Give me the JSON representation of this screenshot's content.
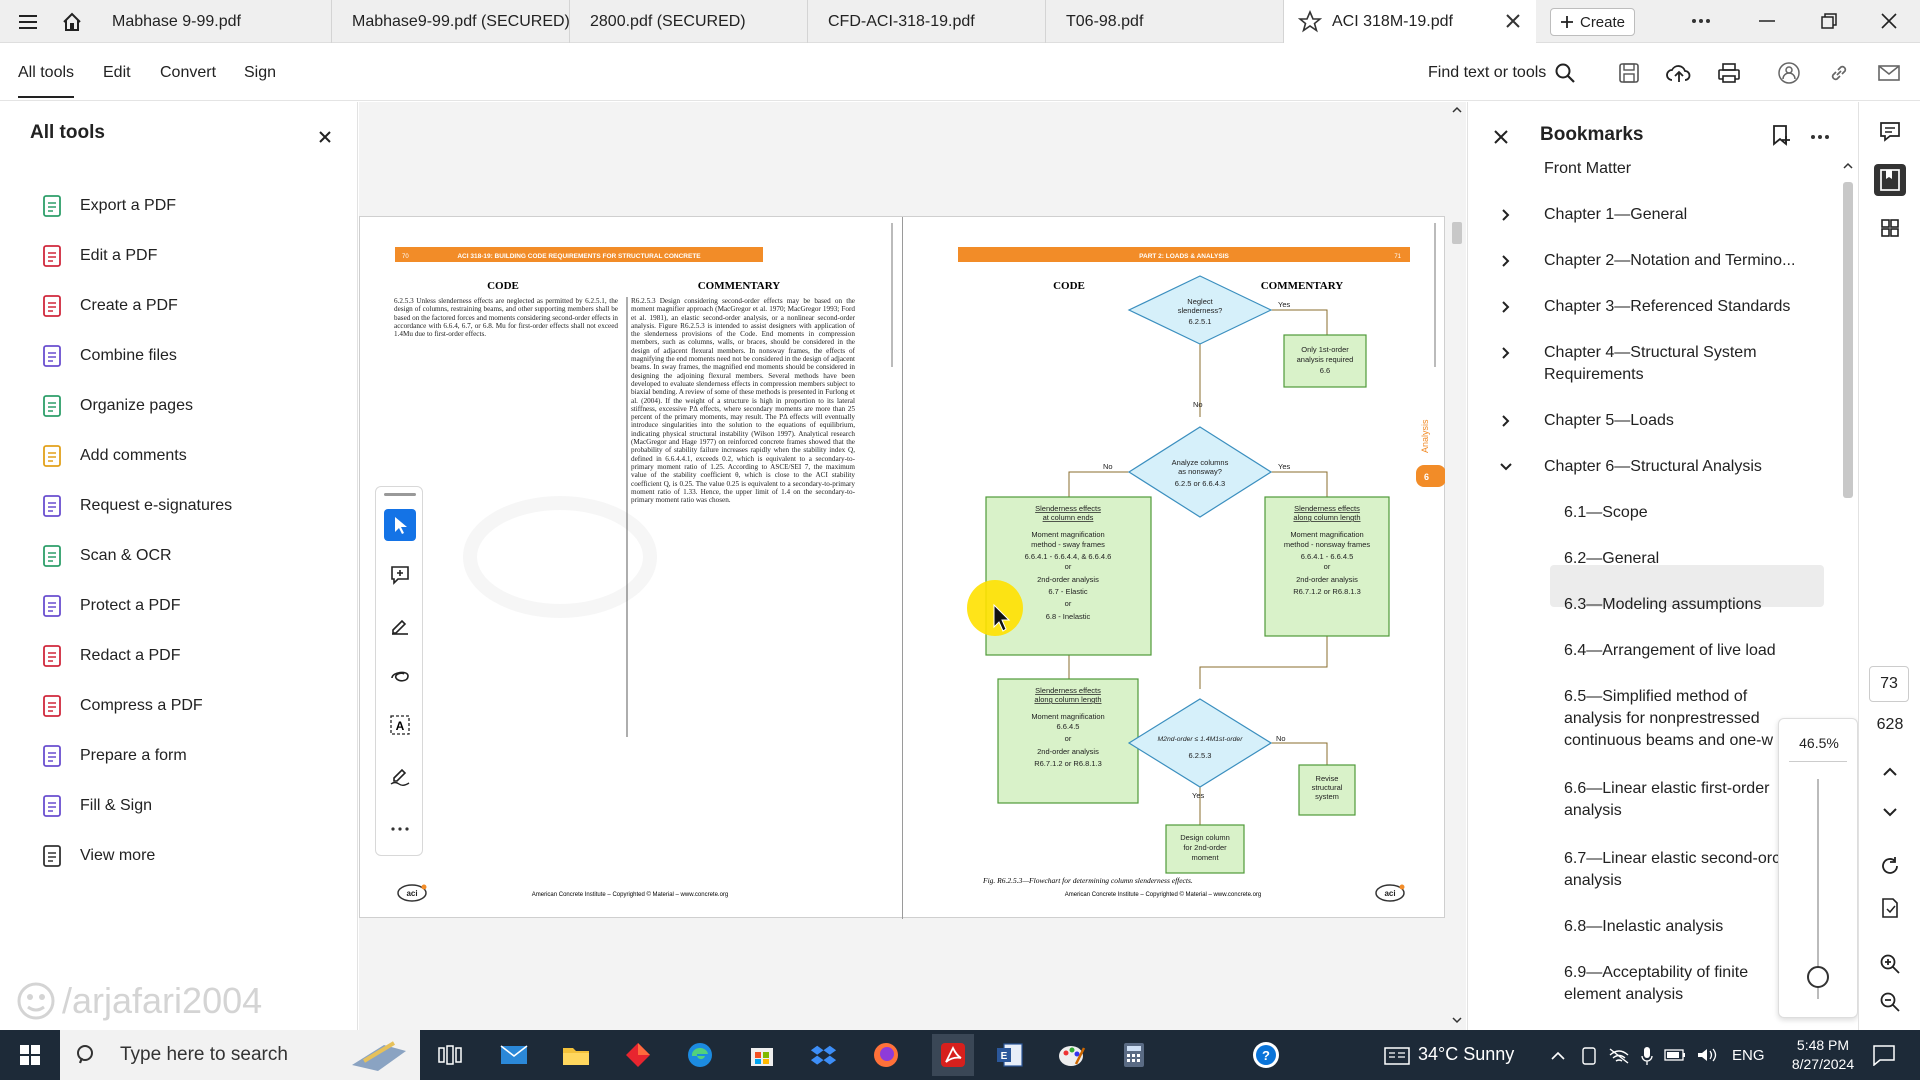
{
  "tabs": [
    {
      "label": "Mabhase 9-99.pdf"
    },
    {
      "label": "Mabhase9-99.pdf (SECURED)"
    },
    {
      "label": "2800.pdf (SECURED)"
    },
    {
      "label": "CFD-ACI-318-19.pdf"
    },
    {
      "label": "T06-98.pdf"
    },
    {
      "label": "ACI 318M-19.pdf"
    }
  ],
  "create_label": "Create",
  "menu": {
    "all_tools": "All tools",
    "edit": "Edit",
    "convert": "Convert",
    "sign": "Sign",
    "find": "Find text or tools"
  },
  "left_panel": {
    "title": "All tools",
    "tools": [
      {
        "label": "Export a PDF",
        "color": "#2e9e6a"
      },
      {
        "label": "Edit a PDF",
        "color": "#d0283c"
      },
      {
        "label": "Create a PDF",
        "color": "#d0283c"
      },
      {
        "label": "Combine files",
        "color": "#6a4fcf"
      },
      {
        "label": "Organize pages",
        "color": "#2e9e6a"
      },
      {
        "label": "Add comments",
        "color": "#e2a11b"
      },
      {
        "label": "Request e-signatures",
        "color": "#6a4fcf"
      },
      {
        "label": "Scan & OCR",
        "color": "#2e9e6a"
      },
      {
        "label": "Protect a PDF",
        "color": "#6a4fcf"
      },
      {
        "label": "Redact a PDF",
        "color": "#d0283c"
      },
      {
        "label": "Compress a PDF",
        "color": "#d0283c"
      },
      {
        "label": "Prepare a form",
        "color": "#6a4fcf"
      },
      {
        "label": "Fill & Sign",
        "color": "#6a4fcf"
      },
      {
        "label": "View more",
        "color": "#333333"
      }
    ],
    "watermark": "/arjafari2004"
  },
  "left_page": {
    "header": "ACI 318-19: BUILDING CODE REQUIREMENTS FOR STRUCTURAL CONCRETE",
    "page_no": "70",
    "code_heading": "CODE",
    "commentary_heading": "COMMENTARY",
    "code_text": "6.2.5.3 Unless slenderness effects are neglected as permitted by 6.2.5.1, the design of columns, restraining beams, and other supporting members shall be based on the factored forces and moments considering second-order effects in accordance with 6.6.4, 6.7, or 6.8. Mu for first-order effects shall not exceed 1.4Mu due to first-order effects.",
    "commentary_text": "R6.2.5.3 Design considering second-order effects may be based on the moment magnifier approach (MacGregor et al. 1970; MacGregor 1993; Ford et al. 1981), an elastic second-order analysis, or a nonlinear second-order analysis. Figure R6.2.5.3 is intended to assist designers with application of the slenderness provisions of the Code. End moments in compression members, such as columns, walls, or braces, should be considered in the design of adjacent flexural members. In nonsway frames, the effects of magnifying the end moments need not be considered in the design of adjacent beams. In sway frames, the magnified end moments should be considered in designing the adjoining flexural members. Several methods have been developed to evaluate slenderness effects in compression members subject to biaxial bending. A review of some of these methods is presented in Furlong et al. (2004). If the weight of a structure is high in proportion to its lateral stiffness, excessive PΔ effects, where secondary moments are more than 25 percent of the primary moments, may result. The PΔ effects will eventually introduce singularities into the solution to the equations of equilibrium, indicating physical structural instability (Wilson 1997). Analytical research (MacGregor and Hage 1977) on reinforced concrete frames showed that the probability of stability failure increases rapidly when the stability index Q, defined in 6.6.4.4.1, exceeds 0.2, which is equivalent to a secondary-to-primary moment ratio of 1.25. According to ASCE/SEI 7, the maximum value of the stability coefficient θ, which is close to the ACI stability coefficient Q, is 0.25. The value 0.25 is equivalent to a secondary-to-primary moment ratio of 1.33. Hence, the upper limit of 1.4 on the secondary-to-primary moment ratio was chosen.",
    "footer": "American Concrete Institute – Copyrighted © Material – www.concrete.org"
  },
  "right_page": {
    "header": "PART 2: LOADS & ANALYSIS",
    "page_no": "71",
    "code_heading": "CODE",
    "commentary_heading": "COMMENTARY",
    "side_tab": "Analysis",
    "side_tab_no": "6",
    "flow": {
      "d1": [
        "Neglect",
        "slenderness?",
        "6.2.5.1"
      ],
      "yes": "Yes",
      "no": "No",
      "b1": [
        "Only 1st-order",
        "analysis required",
        "6.6"
      ],
      "d2": [
        "Analyze columns",
        "as nonsway?",
        "6.2.5 or 6.6.4.3"
      ],
      "b2_title": [
        "Slenderness effects",
        "at column ends"
      ],
      "b2_body": [
        "Moment magnification",
        "method - sway frames",
        "6.6.4.1 - 6.6.4.4, & 6.6.4.6",
        "or",
        "2nd-order analysis",
        "6.7 - Elastic",
        "or",
        "6.8 - Inelastic"
      ],
      "b3_title": [
        "Slenderness effects",
        "along column length"
      ],
      "b3_body": [
        "Moment magnification",
        "method - nonsway frames",
        "6.6.4.1 - 6.6.4.5",
        "or",
        "2nd-order analysis",
        "R6.7.1.2 or R6.8.1.3"
      ],
      "b4_title": [
        "Slenderness effects",
        "along column length"
      ],
      "b4_body": [
        "Moment magnification",
        "6.6.4.5",
        "or",
        "2nd-order analysis",
        "R6.7.1.2 or R6.8.1.3"
      ],
      "d3": [
        "M2nd-order ≤ 1.4M1st-order",
        "6.2.5.3"
      ],
      "b5": [
        "Revise",
        "structural",
        "system"
      ],
      "b6": [
        "Design column",
        "for 2nd-order",
        "moment"
      ]
    },
    "caption": "Fig. R6.2.5.3—Flowchart for determining column slenderness effects.",
    "footer": "American Concrete Institute – Copyrighted © Material – www.concrete.org"
  },
  "bookmarks": {
    "title": "Bookmarks",
    "items": [
      {
        "label": "Front Matter"
      },
      {
        "label": "Chapter 1—General"
      },
      {
        "label": "Chapter 2—Notation and Termino..."
      },
      {
        "label": "Chapter 3—Referenced Standards"
      },
      {
        "label": "Chapter 4—Structural System",
        "label2": "Requirements"
      },
      {
        "label": "Chapter 5—Loads"
      },
      {
        "label": "Chapter 6—Structural Analysis"
      },
      {
        "label": "6.1—Scope"
      },
      {
        "label": "6.2—General"
      },
      {
        "label": "6.3—Modeling assumptions"
      },
      {
        "label": "6.4—Arrangement of live load"
      },
      {
        "label": "6.5—Simplified method of",
        "label2": "analysis for nonprestressed",
        "label3": "continuous beams and one-w"
      },
      {
        "label": "6.6—Linear elastic first-order",
        "label2": "analysis"
      },
      {
        "label": "6.7—Linear elastic second-orc",
        "label2": "analysis"
      },
      {
        "label": "6.8—Inelastic analysis"
      },
      {
        "label": "6.9—Acceptability of finite",
        "label2": "element analysis"
      }
    ]
  },
  "zoom": {
    "value": "46.5%",
    "level": 0.465
  },
  "page_nav": {
    "current": "73",
    "total": "628"
  },
  "taskbar": {
    "search_placeholder": "Type here to search",
    "weather": "34°C  Sunny",
    "lang": "ENG",
    "time": "5:48 PM",
    "date": "8/27/2024"
  },
  "colors": {
    "accent": "#1473e6",
    "orange_band": "#f28c28",
    "flow_diamond": "#d6f0fa",
    "flow_box": "#d9f2c9",
    "pointer": "#ffe100"
  }
}
